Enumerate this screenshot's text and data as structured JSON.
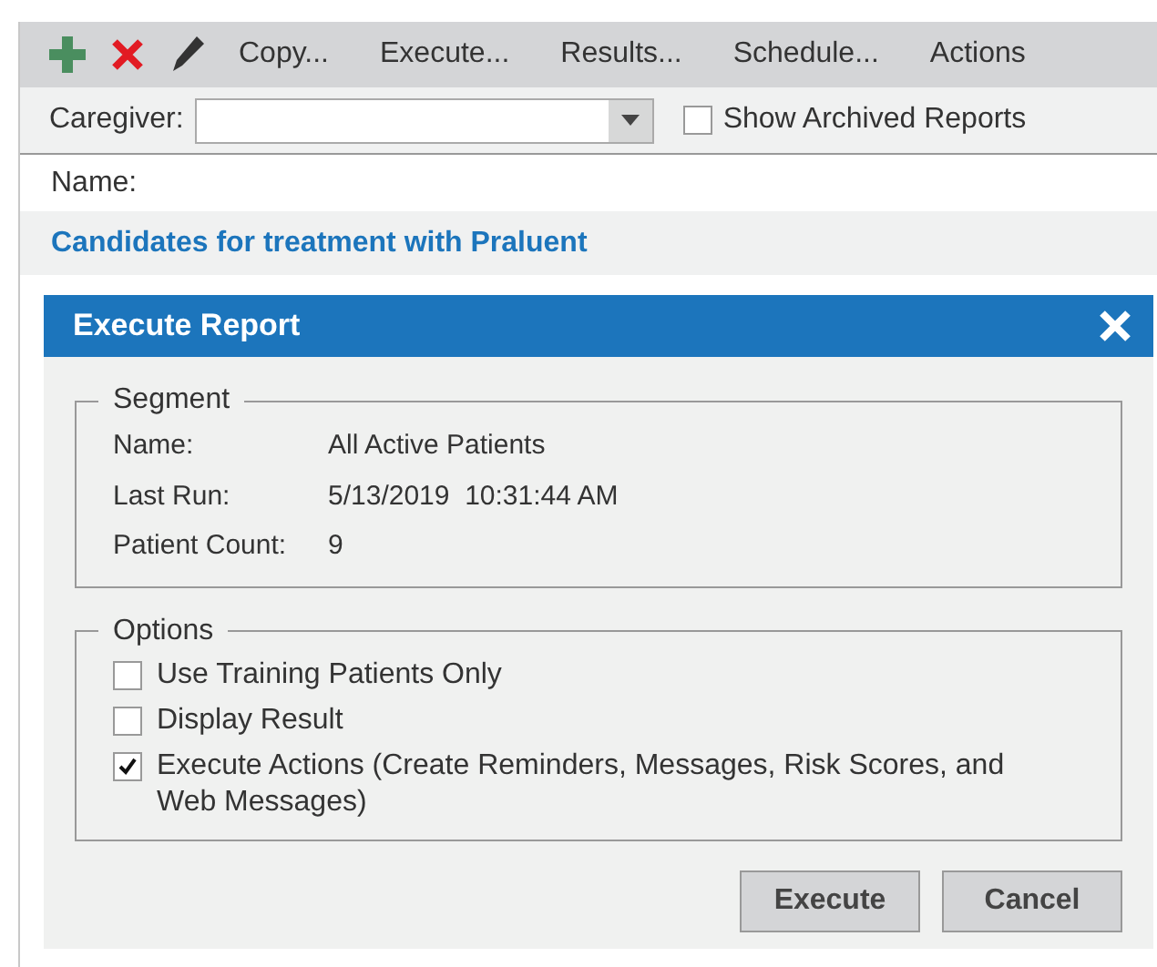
{
  "toolbar": {
    "icons": [
      {
        "kind": "add"
      },
      {
        "kind": "delete"
      },
      {
        "kind": "edit"
      }
    ],
    "buttons": [
      "Copy...",
      "Execute...",
      "Results...",
      "Schedule...",
      "Actions"
    ]
  },
  "filter": {
    "caregiver_label": "Caregiver:",
    "show_archived": {
      "label": "Show Archived Reports",
      "checked": false
    }
  },
  "name_label": "Name:",
  "report_name": "Candidates for treatment with Praluent",
  "dialog": {
    "title": "Execute Report",
    "segment": {
      "legend": "Segment",
      "fields": [
        {
          "label": "Name:",
          "value": "All Active Patients"
        },
        {
          "label": "Last Run:",
          "value": "5/13/2019  10:31:44 AM"
        },
        {
          "label": "Patient Count:",
          "value": "9"
        }
      ]
    },
    "options": {
      "legend": "Options",
      "items": [
        {
          "label": "Use Training Patients Only",
          "checked": false
        },
        {
          "label": "Display Result",
          "checked": false
        },
        {
          "label": "Execute Actions (Create Reminders, Messages, Risk Scores, and Web Messages)",
          "checked": true
        }
      ]
    },
    "buttons": [
      "Execute",
      "Cancel"
    ]
  }
}
